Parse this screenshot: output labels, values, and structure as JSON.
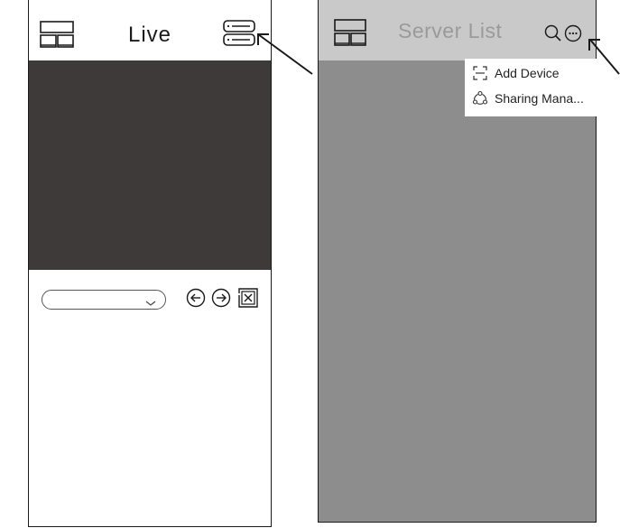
{
  "live_screen": {
    "title": "Live",
    "icons": {
      "layout": "split-layout-icon",
      "server_list": "server-list-icon",
      "dropdown": "chevron-down-icon",
      "prev": "arrow-left-circle-icon",
      "next": "arrow-right-circle-icon",
      "close": "close-box-icon"
    },
    "select_value": ""
  },
  "server_screen": {
    "title": "Server List",
    "icons": {
      "layout": "split-layout-icon",
      "search": "search-icon",
      "more": "more-options-icon"
    },
    "menu": [
      {
        "label": "Add Device",
        "icon": "scan-icon"
      },
      {
        "label": "Sharing Mana...",
        "icon": "share-icon"
      }
    ]
  },
  "colors": {
    "video_area": "#3e3a39",
    "server_bg": "#8d8d8d",
    "server_header": "#c9c9c9",
    "server_title": "#9a9a9a"
  }
}
